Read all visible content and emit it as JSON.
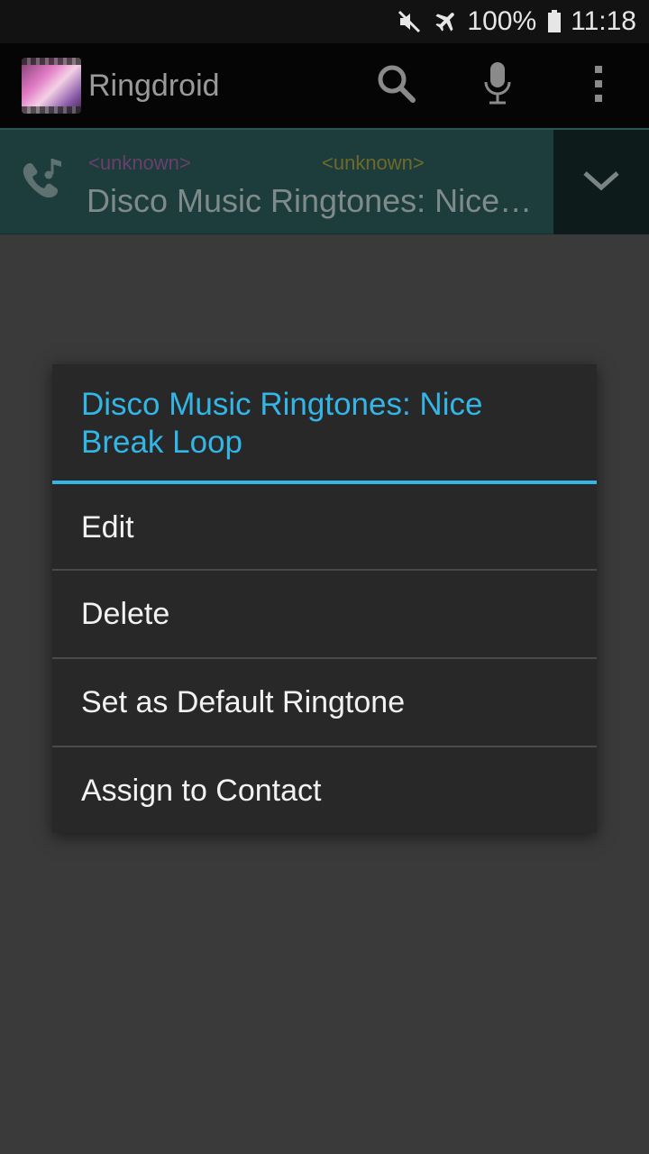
{
  "status_bar": {
    "battery": "100%",
    "time": "11:18",
    "icons": [
      "mute-icon",
      "airplane-icon",
      "battery-icon"
    ]
  },
  "action_bar": {
    "title": "Ringdroid",
    "actions": [
      "search-icon",
      "microphone-icon",
      "overflow-menu-icon"
    ]
  },
  "list_row": {
    "artist": "<unknown>",
    "album": "<unknown>",
    "title": "Disco Music Ringtones: Nice…",
    "icon": "ringtone-phone-icon",
    "expand_icon": "chevron-down-icon"
  },
  "dialog": {
    "title": "Disco Music Ringtones: Nice Break Loop",
    "items": [
      {
        "label": "Edit"
      },
      {
        "label": "Delete"
      },
      {
        "label": "Set as Default Ringtone"
      },
      {
        "label": "Assign to Contact"
      }
    ]
  },
  "colors": {
    "accent": "#33b5e5",
    "row_background": "#1d3c3c",
    "dialog_background": "#282828",
    "screen_background": "#3a3a3a"
  }
}
